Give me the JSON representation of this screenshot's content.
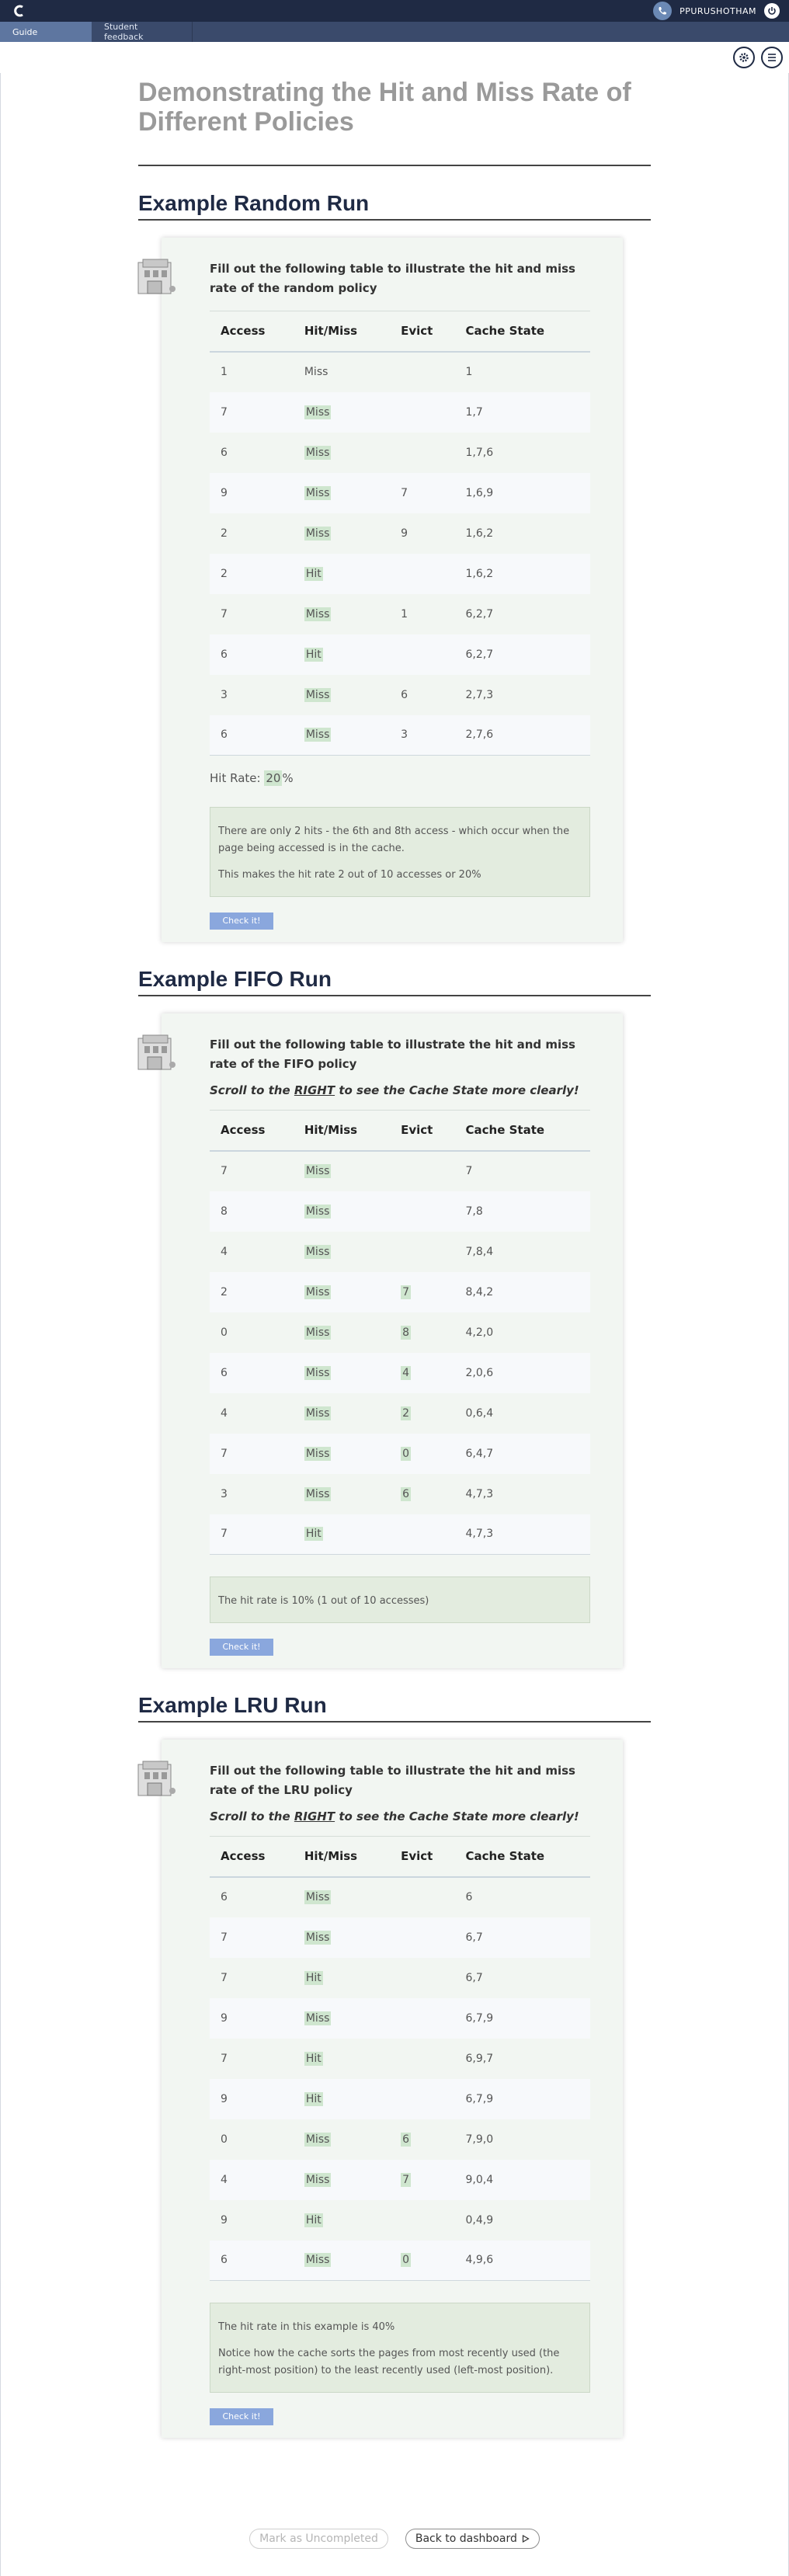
{
  "header": {
    "username": "PPURUSHOTHAM"
  },
  "tabs": [
    {
      "label": "Guide"
    },
    {
      "label": "Student feedback"
    }
  ],
  "page_title": "Demonstrating the Hit and Miss Rate of Different Policies",
  "table_headers": [
    "Access",
    "Hit/Miss",
    "Evict",
    "Cache State"
  ],
  "check_label": "Check it!",
  "sections": [
    {
      "title": "Example Random Run",
      "prompt": "Fill out the following table to illustrate the hit and miss rate of the random policy",
      "scroll_note": {
        "before": "Scroll to the ",
        "link": "RIGHT",
        "after": " to see the Cache State more clearly!"
      },
      "has_scroll_note": false,
      "rows": [
        {
          "access": "1",
          "result": "Miss",
          "evict": "",
          "state": "1",
          "result_fill": false,
          "evict_fill": false
        },
        {
          "access": "7",
          "result": "Miss",
          "evict": "",
          "state": "1,7",
          "result_fill": true,
          "evict_fill": false
        },
        {
          "access": "6",
          "result": "Miss",
          "evict": "",
          "state": "1,7,6",
          "result_fill": true,
          "evict_fill": false
        },
        {
          "access": "9",
          "result": "Miss",
          "evict": "7",
          "state": "1,6,9",
          "result_fill": true,
          "evict_fill": false
        },
        {
          "access": "2",
          "result": "Miss",
          "evict": "9",
          "state": "1,6,2",
          "result_fill": true,
          "evict_fill": false
        },
        {
          "access": "2",
          "result": "Hit",
          "evict": "",
          "state": "1,6,2",
          "result_fill": true,
          "evict_fill": false
        },
        {
          "access": "7",
          "result": "Miss",
          "evict": "1",
          "state": "6,2,7",
          "result_fill": true,
          "evict_fill": false
        },
        {
          "access": "6",
          "result": "Hit",
          "evict": "",
          "state": "6,2,7",
          "result_fill": true,
          "evict_fill": false
        },
        {
          "access": "3",
          "result": "Miss",
          "evict": "6",
          "state": "2,7,3",
          "result_fill": true,
          "evict_fill": false
        },
        {
          "access": "6",
          "result": "Miss",
          "evict": "3",
          "state": "2,7,6",
          "result_fill": true,
          "evict_fill": false
        }
      ],
      "hit_rate": {
        "label": "Hit Rate: ",
        "value": "20",
        "suffix": "%"
      },
      "notes": [
        "There are only 2 hits - the 6th and 8th access - which occur when the page being accessed is in the cache.",
        "This makes the hit rate 2 out of 10 accesses or 20%"
      ]
    },
    {
      "title": "Example FIFO Run",
      "prompt": "Fill out the following table to illustrate the hit and miss rate of the FIFO policy",
      "scroll_note": {
        "before": "Scroll to the ",
        "link": "RIGHT",
        "after": " to see the Cache State more clearly!"
      },
      "has_scroll_note": true,
      "rows": [
        {
          "access": "7",
          "result": "Miss",
          "evict": "",
          "state": "7",
          "result_fill": true,
          "evict_fill": false
        },
        {
          "access": "8",
          "result": "Miss",
          "evict": "",
          "state": "7,8",
          "result_fill": true,
          "evict_fill": false
        },
        {
          "access": "4",
          "result": "Miss",
          "evict": "",
          "state": "7,8,4",
          "result_fill": true,
          "evict_fill": false
        },
        {
          "access": "2",
          "result": "Miss",
          "evict": "7",
          "state": "8,4,2",
          "result_fill": true,
          "evict_fill": true
        },
        {
          "access": "0",
          "result": "Miss",
          "evict": "8",
          "state": "4,2,0",
          "result_fill": true,
          "evict_fill": true
        },
        {
          "access": "6",
          "result": "Miss",
          "evict": "4",
          "state": "2,0,6",
          "result_fill": true,
          "evict_fill": true
        },
        {
          "access": "4",
          "result": "Miss",
          "evict": "2",
          "state": "0,6,4",
          "result_fill": true,
          "evict_fill": true
        },
        {
          "access": "7",
          "result": "Miss",
          "evict": "0",
          "state": "6,4,7",
          "result_fill": true,
          "evict_fill": true
        },
        {
          "access": "3",
          "result": "Miss",
          "evict": "6",
          "state": "4,7,3",
          "result_fill": true,
          "evict_fill": true
        },
        {
          "access": "7",
          "result": "Hit",
          "evict": "",
          "state": "4,7,3",
          "result_fill": true,
          "evict_fill": false
        }
      ],
      "notes": [
        "The hit rate is 10% (1 out of 10 accesses)"
      ]
    },
    {
      "title": "Example LRU Run",
      "prompt": "Fill out the following table to illustrate the hit and miss rate of the LRU policy",
      "scroll_note": {
        "before": "Scroll to the ",
        "link": "RIGHT",
        "after": " to see the Cache State more clearly!"
      },
      "has_scroll_note": true,
      "rows": [
        {
          "access": "6",
          "result": "Miss",
          "evict": "",
          "state": "6",
          "result_fill": true,
          "evict_fill": false
        },
        {
          "access": "7",
          "result": "Miss",
          "evict": "",
          "state": "6,7",
          "result_fill": true,
          "evict_fill": false
        },
        {
          "access": "7",
          "result": "Hit",
          "evict": "",
          "state": "6,7",
          "result_fill": true,
          "evict_fill": false
        },
        {
          "access": "9",
          "result": "Miss",
          "evict": "",
          "state": "6,7,9",
          "result_fill": true,
          "evict_fill": false
        },
        {
          "access": "7",
          "result": "Hit",
          "evict": "",
          "state": "6,9,7",
          "result_fill": true,
          "evict_fill": false
        },
        {
          "access": "9",
          "result": "Hit",
          "evict": "",
          "state": "6,7,9",
          "result_fill": true,
          "evict_fill": false
        },
        {
          "access": "0",
          "result": "Miss",
          "evict": "6",
          "state": "7,9,0",
          "result_fill": true,
          "evict_fill": true
        },
        {
          "access": "4",
          "result": "Miss",
          "evict": "7",
          "state": "9,0,4",
          "result_fill": true,
          "evict_fill": true
        },
        {
          "access": "9",
          "result": "Hit",
          "evict": "",
          "state": "0,4,9",
          "result_fill": true,
          "evict_fill": false
        },
        {
          "access": "6",
          "result": "Miss",
          "evict": "0",
          "state": "4,9,6",
          "result_fill": true,
          "evict_fill": true
        }
      ],
      "notes": [
        "The hit rate in this example is 40%",
        "Notice how the cache sorts the pages from most recently used (the right-most position) to the least recently used (left-most position)."
      ]
    }
  ],
  "footer": {
    "uncompleted_label": "Mark as Uncompleted",
    "dashboard_label": "Back to dashboard"
  }
}
